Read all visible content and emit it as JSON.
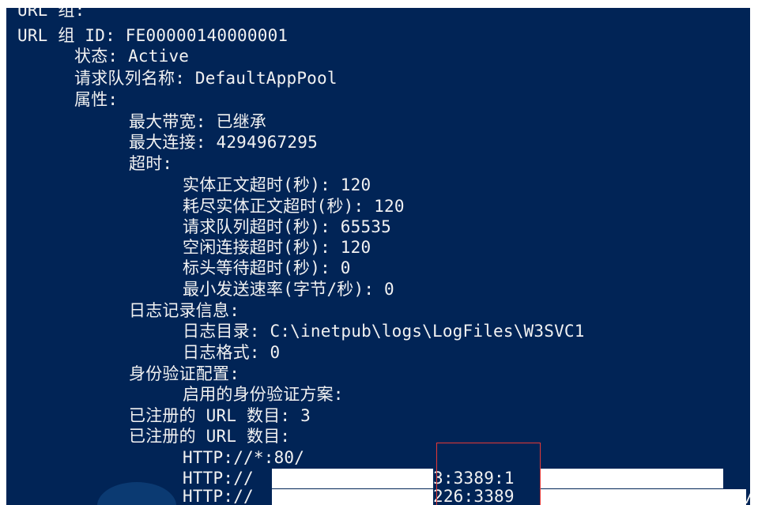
{
  "console": {
    "lines": {
      "url_group_header": "URL 组:",
      "url_group_id": "URL 组 ID: FE00000140000001",
      "state": "状态: Active",
      "queue_name": "请求队列名称: DefaultAppPool",
      "properties": "属性:",
      "max_bandwidth": "最大带宽: 已继承",
      "max_connections": "最大连接: 4294967295",
      "timeouts": "超时:",
      "entity_body_timeout": "实体正文超时(秒): 120",
      "drain_entity_body_timeout": "耗尽实体正文超时(秒): 120",
      "request_queue_timeout": "请求队列超时(秒): 65535",
      "idle_connection_timeout": "空闲连接超时(秒): 120",
      "header_wait_timeout": "标头等待超时(秒): 0",
      "min_send_rate": "最小发送速率(字节/秒): 0",
      "logging_info": "日志记录信息:",
      "log_directory": "日志目录: C:\\inetpub\\logs\\LogFiles\\W3SVC1",
      "log_format": "日志格式: 0",
      "auth_config": "身份验证配置:",
      "enabled_auth_schemes": "启用的身份验证方案:",
      "registered_url_count": "已注册的 URL 数目: 3",
      "registered_urls": "已注册的 URL 数目:",
      "url_1": "HTTP://*:80/",
      "url_2_prefix": "HTTP://",
      "url_2_visible": "3:3389:1",
      "url_3_prefix": "HTTP://",
      "url_3_visible": "226:3389",
      "url_3_tail": "/"
    }
  },
  "colors": {
    "console_background": "#012456",
    "console_text": "#f2f2f2",
    "highlight_box": "#e53935",
    "redaction": "#ffffff"
  }
}
